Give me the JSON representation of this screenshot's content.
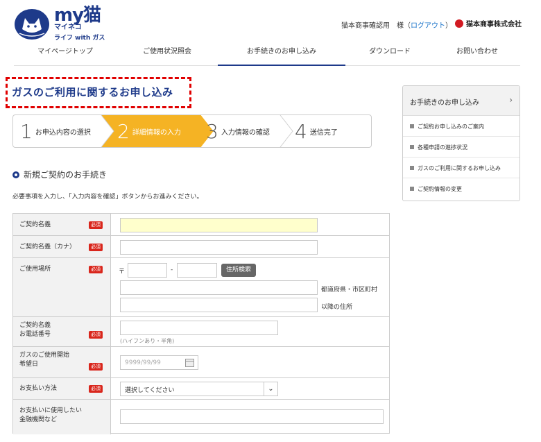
{
  "header": {
    "logo": {
      "main": "my猫",
      "kana": "マイネコ",
      "sub": "ライフ with ガス"
    },
    "user_name": "猫本商事確認用　様",
    "logout_prefix": "（",
    "logout_label": "ログアウト",
    "logout_suffix": "）",
    "company": "猫本商事株式会社"
  },
  "nav": {
    "items": [
      {
        "label": "マイページトップ"
      },
      {
        "label": "ご使用状況照会"
      },
      {
        "label": "お手続きのお申し込み"
      },
      {
        "label": "ダウンロード"
      },
      {
        "label": "お問い合わせ"
      }
    ]
  },
  "page": {
    "title": "ガスのご利用に関するお申し込み",
    "section_title": "新規ご契約のお手続き",
    "instruction": "必要事項を入力し、「入力内容を確認」ボタンからお進みください。"
  },
  "steps": [
    {
      "num": "1",
      "label": "お申込内容の選択"
    },
    {
      "num": "2",
      "label": "詳細情報の入力"
    },
    {
      "num": "3",
      "label": "入力情報の確認"
    },
    {
      "num": "4",
      "label": "送信完了"
    }
  ],
  "form": {
    "required_badge": "必須",
    "contract_name": {
      "label": "ご契約名義",
      "value": ""
    },
    "contract_name_kana": {
      "label": "ご契約名義（カナ）",
      "value": ""
    },
    "usage_place": {
      "label": "ご使用場所",
      "postal_mark": "〒",
      "postal_sep": "-",
      "search_button": "住所検索",
      "pref_city_label": "都道府県・市区町村",
      "rest_label": "以降の住所"
    },
    "phone": {
      "label_line1": "ご契約名義",
      "label_line2": "お電話番号",
      "hint": "(ハイフンあり・半角)"
    },
    "start_date": {
      "label_line1": "ガスのご使用開始",
      "label_line2": "希望日",
      "placeholder": "9999/99/99"
    },
    "payment": {
      "label": "お支払い方法",
      "selected": "選択してください"
    },
    "bank": {
      "label_line1": "お支払いに使用したい",
      "label_line2": "金融機関など"
    }
  },
  "sidebar": {
    "header": "お手続きのお申し込み",
    "items": [
      {
        "label": "ご契約お申し込みのご案内"
      },
      {
        "label": "各種申請の進捗状況"
      },
      {
        "label": "ガスのご利用に関するお申し込み"
      },
      {
        "label": "ご契約情報の変更"
      }
    ]
  },
  "colors": {
    "brand": "#1e3a8a",
    "step_active": "#f5b324",
    "required": "#d9261c",
    "highlight_dash": "#e00000"
  }
}
